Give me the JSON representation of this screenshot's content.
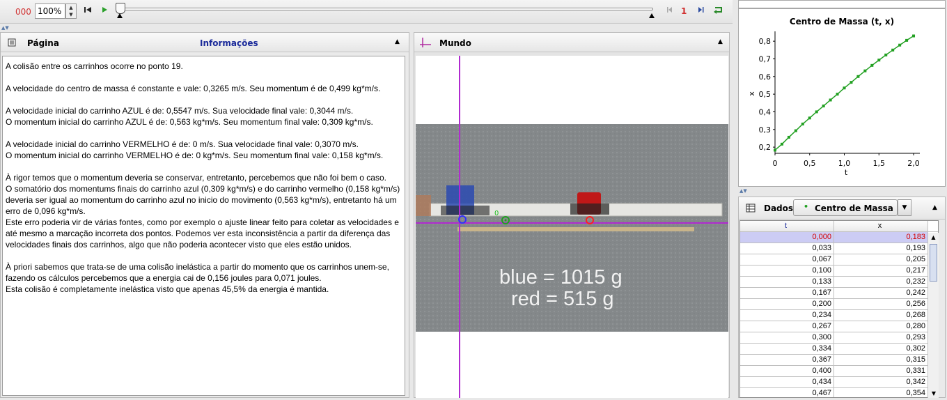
{
  "toolbar": {
    "frame_counter": "000",
    "zoom": "100%",
    "step_count": "1"
  },
  "info_panel": {
    "title": "Página",
    "tab": "Informações",
    "paragraphs": [
      "A colisão entre os carrinhos ocorre no ponto 19.",
      "A velocidade do centro de massa é constante e vale:  0,3265 m/s. Seu momentum é de 0,499 kg*m/s.",
      "A velocidade inicial do carrinho AZUL é de:  0,5547 m/s. Sua velocidade final vale:  0,3044 m/s.",
      "O momentum inicial do carrinho AZUL é de:  0,563 kg*m/s. Seu momentum final vale:  0,309 kg*m/s.",
      "A velocidade inicial do carrinho VERMELHO é de:  0 m/s. Sua velocidade final vale:  0,3070 m/s.",
      "O momentum inicial do carrinho VERMELHO é de:  0 kg*m/s. Seu momentum final vale:  0,158 kg*m/s.",
      "À rigor temos que o momentum deveria se conservar, entretanto, percebemos que não foi bem o caso.",
      "O somatório dos momentums finais do carrinho azul (0,309 kg*m/s) e do carrinho vermelho (0,158 kg*m/s)",
      "deveria ser igual ao momentum do carrinho azul no inicio do movimento (0,563 kg*m/s), entretanto há um erro de 0,096 kg*m/s.",
      "Este erro poderia vir de várias fontes, como por exemplo o ajuste linear feito para coletar as velocidades e até mesmo a marcação incorreta dos pontos. Podemos ver esta inconsistência a partir da diferença das velocidades finais dos carrinhos, algo que não poderia acontecer visto que eles estão unidos.",
      "À priori sabemos que trata-se de uma colisão inelástica a partir do momento que os carrinhos unem-se, fazendo os cálculos percebemos que a energia cai de 0,156 joules para 0,071 joules.",
      "Esta colisão é completamente inelástica visto que apenas 45,5% da energia é mantida."
    ]
  },
  "world_panel": {
    "title": "Mundo",
    "video_text_line1": "blue = 1015 g",
    "video_text_line2": "red = 515 g",
    "marker_label": "0"
  },
  "chart_data": {
    "type": "line",
    "title": "Centro de Massa (t, x)",
    "xlabel": "t",
    "ylabel": "x",
    "xlim": [
      0,
      2.05
    ],
    "ylim": [
      0.165,
      0.84
    ],
    "xticks": [
      "0",
      "0,5",
      "1,0",
      "1,5",
      "2,0"
    ],
    "yticks": [
      "0,2",
      "0,3",
      "0,4",
      "0,5",
      "0,6",
      "0,7",
      "0,8"
    ],
    "x": [
      0.0,
      0.1,
      0.2,
      0.3,
      0.4,
      0.5,
      0.6,
      0.7,
      0.8,
      0.9,
      1.0,
      1.1,
      1.2,
      1.3,
      1.4,
      1.5,
      1.6,
      1.7,
      1.8,
      1.9,
      2.0
    ],
    "y": [
      0.183,
      0.217,
      0.256,
      0.293,
      0.331,
      0.365,
      0.4,
      0.433,
      0.467,
      0.5,
      0.535,
      0.567,
      0.6,
      0.632,
      0.663,
      0.693,
      0.722,
      0.75,
      0.778,
      0.805,
      0.83
    ],
    "color": "#22a022",
    "grid": false
  },
  "data_panel": {
    "title": "Dados",
    "dropdown": "Centro de Massa",
    "columns": [
      "t",
      "x"
    ],
    "rows": [
      [
        "0,000",
        "0,183"
      ],
      [
        "0,033",
        "0,193"
      ],
      [
        "0,067",
        "0,205"
      ],
      [
        "0,100",
        "0,217"
      ],
      [
        "0,133",
        "0,232"
      ],
      [
        "0,167",
        "0,242"
      ],
      [
        "0,200",
        "0,256"
      ],
      [
        "0,234",
        "0,268"
      ],
      [
        "0,267",
        "0,280"
      ],
      [
        "0,300",
        "0,293"
      ],
      [
        "0,334",
        "0,302"
      ],
      [
        "0,367",
        "0,315"
      ],
      [
        "0,400",
        "0,331"
      ],
      [
        "0,434",
        "0,342"
      ],
      [
        "0,467",
        "0,354"
      ]
    ]
  }
}
